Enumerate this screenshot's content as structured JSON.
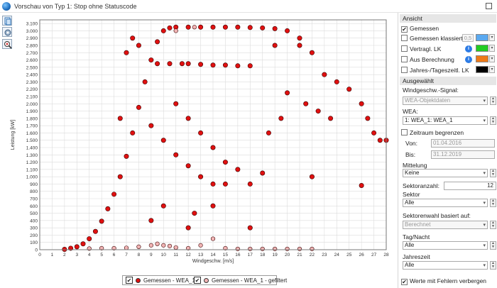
{
  "window": {
    "title": "Vorschau von Typ 1: Stop ohne Statuscode"
  },
  "toolbar": [
    "export-icon",
    "settings-icon",
    "zoom-icon"
  ],
  "chart_data": {
    "type": "scatter",
    "title": "",
    "xlabel": "Windgeschw. [m/s]",
    "ylabel": "Leistung [kW]",
    "xlim": [
      0,
      28
    ],
    "ylim": [
      0,
      3150
    ],
    "grid": true,
    "x_ticks": [
      0,
      1,
      2,
      3,
      4,
      5,
      6,
      7,
      8,
      9,
      10,
      11,
      12,
      13,
      14,
      15,
      16,
      17,
      18,
      19,
      20,
      21,
      22,
      23,
      24,
      25,
      26,
      27,
      28
    ],
    "y_ticks": [
      0,
      100,
      200,
      300,
      400,
      500,
      600,
      700,
      800,
      900,
      1000,
      1100,
      1200,
      1300,
      1400,
      1500,
      1600,
      1700,
      1800,
      1900,
      2000,
      2100,
      2200,
      2300,
      2400,
      2500,
      2600,
      2700,
      2800,
      2900,
      3000,
      3100
    ],
    "y_tick_labels": [
      "0",
      "100",
      "200",
      "300",
      "400",
      "500",
      "600",
      "700",
      "800",
      "900",
      "1.000",
      "1.100",
      "1.200",
      "1.300",
      "1.400",
      "1.500",
      "1.600",
      "1.700",
      "1.800",
      "1.900",
      "2.000",
      "2.100",
      "2.200",
      "2.300",
      "2.400",
      "2.500",
      "2.600",
      "2.700",
      "2.800",
      "2.900",
      "3.000",
      "3.100"
    ],
    "series": [
      {
        "name": "Gemessen - WEA_1",
        "color": "#e01010",
        "points": [
          [
            2,
            5
          ],
          [
            2.5,
            20
          ],
          [
            3,
            40
          ],
          [
            3.5,
            80
          ],
          [
            4,
            150
          ],
          [
            4.5,
            250
          ],
          [
            5,
            390
          ],
          [
            5.5,
            560
          ],
          [
            6,
            760
          ],
          [
            6.5,
            1000
          ],
          [
            7,
            1280
          ],
          [
            7.5,
            1600
          ],
          [
            8,
            1950
          ],
          [
            8.5,
            2300
          ],
          [
            9,
            2600
          ],
          [
            9.5,
            2850
          ],
          [
            10,
            3000
          ],
          [
            10.5,
            3040
          ],
          [
            11,
            3050
          ],
          [
            12,
            3050
          ],
          [
            13,
            3050
          ],
          [
            14,
            3050
          ],
          [
            15,
            3050
          ],
          [
            16,
            3050
          ],
          [
            17,
            3045
          ],
          [
            18,
            3040
          ],
          [
            19,
            3030
          ],
          [
            20,
            3000
          ],
          [
            21,
            2900
          ],
          [
            22,
            2700
          ],
          [
            23,
            2400
          ],
          [
            24,
            2300
          ],
          [
            25,
            2200
          ],
          [
            26,
            2000
          ],
          [
            26.5,
            1800
          ],
          [
            27,
            1600
          ],
          [
            27.5,
            1500
          ],
          [
            28,
            1500
          ],
          [
            26,
            880
          ],
          [
            23.5,
            1800
          ],
          [
            22.5,
            1900
          ],
          [
            22,
            1000
          ],
          [
            21.5,
            2000
          ],
          [
            20,
            2150
          ],
          [
            19.5,
            1800
          ],
          [
            18.5,
            1600
          ],
          [
            17,
            900
          ],
          [
            15,
            900
          ],
          [
            14,
            900
          ],
          [
            13,
            1000
          ],
          [
            12,
            1150
          ],
          [
            11,
            1300
          ],
          [
            10,
            1500
          ],
          [
            9,
            1700
          ],
          [
            8,
            2800
          ],
          [
            7.5,
            2900
          ],
          [
            7,
            2700
          ],
          [
            6.5,
            1800
          ],
          [
            9.5,
            2550
          ],
          [
            10.5,
            2550
          ],
          [
            11.5,
            2550
          ],
          [
            12,
            2550
          ],
          [
            13,
            2540
          ],
          [
            14,
            2530
          ],
          [
            15,
            2530
          ],
          [
            16,
            2520
          ],
          [
            17,
            2520
          ],
          [
            11,
            2000
          ],
          [
            12,
            1800
          ],
          [
            13,
            1600
          ],
          [
            14,
            1400
          ],
          [
            15,
            1200
          ],
          [
            16,
            1100
          ],
          [
            18,
            1050
          ],
          [
            12.5,
            500
          ],
          [
            12,
            300
          ],
          [
            14,
            600
          ],
          [
            10,
            600
          ],
          [
            9,
            400
          ],
          [
            17,
            300
          ],
          [
            19,
            2800
          ],
          [
            21,
            2800
          ]
        ]
      },
      {
        "name": "Gemessen - WEA_1 - gefiltert",
        "color": "#f2b5b5",
        "points": [
          [
            4,
            15
          ],
          [
            5,
            20
          ],
          [
            6,
            20
          ],
          [
            7,
            25
          ],
          [
            8,
            40
          ],
          [
            9,
            60
          ],
          [
            9.5,
            80
          ],
          [
            10,
            60
          ],
          [
            10.5,
            50
          ],
          [
            11,
            30
          ],
          [
            12,
            20
          ],
          [
            13,
            60
          ],
          [
            14,
            150
          ],
          [
            15,
            20
          ],
          [
            16,
            10
          ],
          [
            17,
            10
          ],
          [
            18,
            10
          ],
          [
            19,
            10
          ],
          [
            20,
            10
          ],
          [
            21,
            10
          ],
          [
            22,
            10
          ],
          [
            11,
            3000
          ],
          [
            12.5,
            3050
          ]
        ]
      }
    ]
  },
  "legend": {
    "items": [
      {
        "label": "Gemessen - WEA_1",
        "checked": "✔",
        "color": "#e01010"
      },
      {
        "label": "Gemessen - WEA_1 - gefiltert",
        "checked": "✔",
        "color": "#f2b5b5"
      }
    ]
  },
  "panel": {
    "ansicht": {
      "header": "Ansicht",
      "gemessen": {
        "label": "Gemessen",
        "check": "✔"
      },
      "klassiert": {
        "label": "Gemessen klassiert",
        "value": "0,5",
        "color": "#5aa9f0"
      },
      "vertragl": {
        "label": "Vertragl. LK",
        "color": "#22cc22"
      },
      "aus_berechnung": {
        "label": "Aus Berechnung",
        "color": "#ee7a18"
      },
      "jahres": {
        "label": "Jahres-/Tageszeitl. LK",
        "color": "#000000"
      },
      "info_glyph": "i"
    },
    "ausgewaehlt": {
      "header": "Ausgewählt",
      "windsignal_label": "Windgeschw.-Signal:",
      "windsignal_value": "WEA-Objektdaten",
      "wea_label": "WEA:",
      "wea_value": "1: WEA_1: WEA_1",
      "zeitraum_label": "Zeitraum begrenzen",
      "von_label": "Von:",
      "von_value": "01.04.2016",
      "bis_label": "Bis:",
      "bis_value": "31.12.2019",
      "mittelung_label": "Mittelung",
      "mittelung_value": "Keine",
      "sektoranzahl_label": "Sektoranzahl:",
      "sektoranzahl_value": "12",
      "sektor_label": "Sektor",
      "sektor_value": "Alle",
      "sektorenwahl_label": "Sektorenwahl basiert auf:",
      "sektorenwahl_value": "Berechnet",
      "tagnacht_label": "Tag/Nacht",
      "tagnacht_value": "Alle",
      "jahreszeit_label": "Jahreszeit",
      "jahreszeit_value": "Alle",
      "fehler_label": "Werte mit Fehlern verbergen",
      "fehler_check": "✔"
    }
  }
}
